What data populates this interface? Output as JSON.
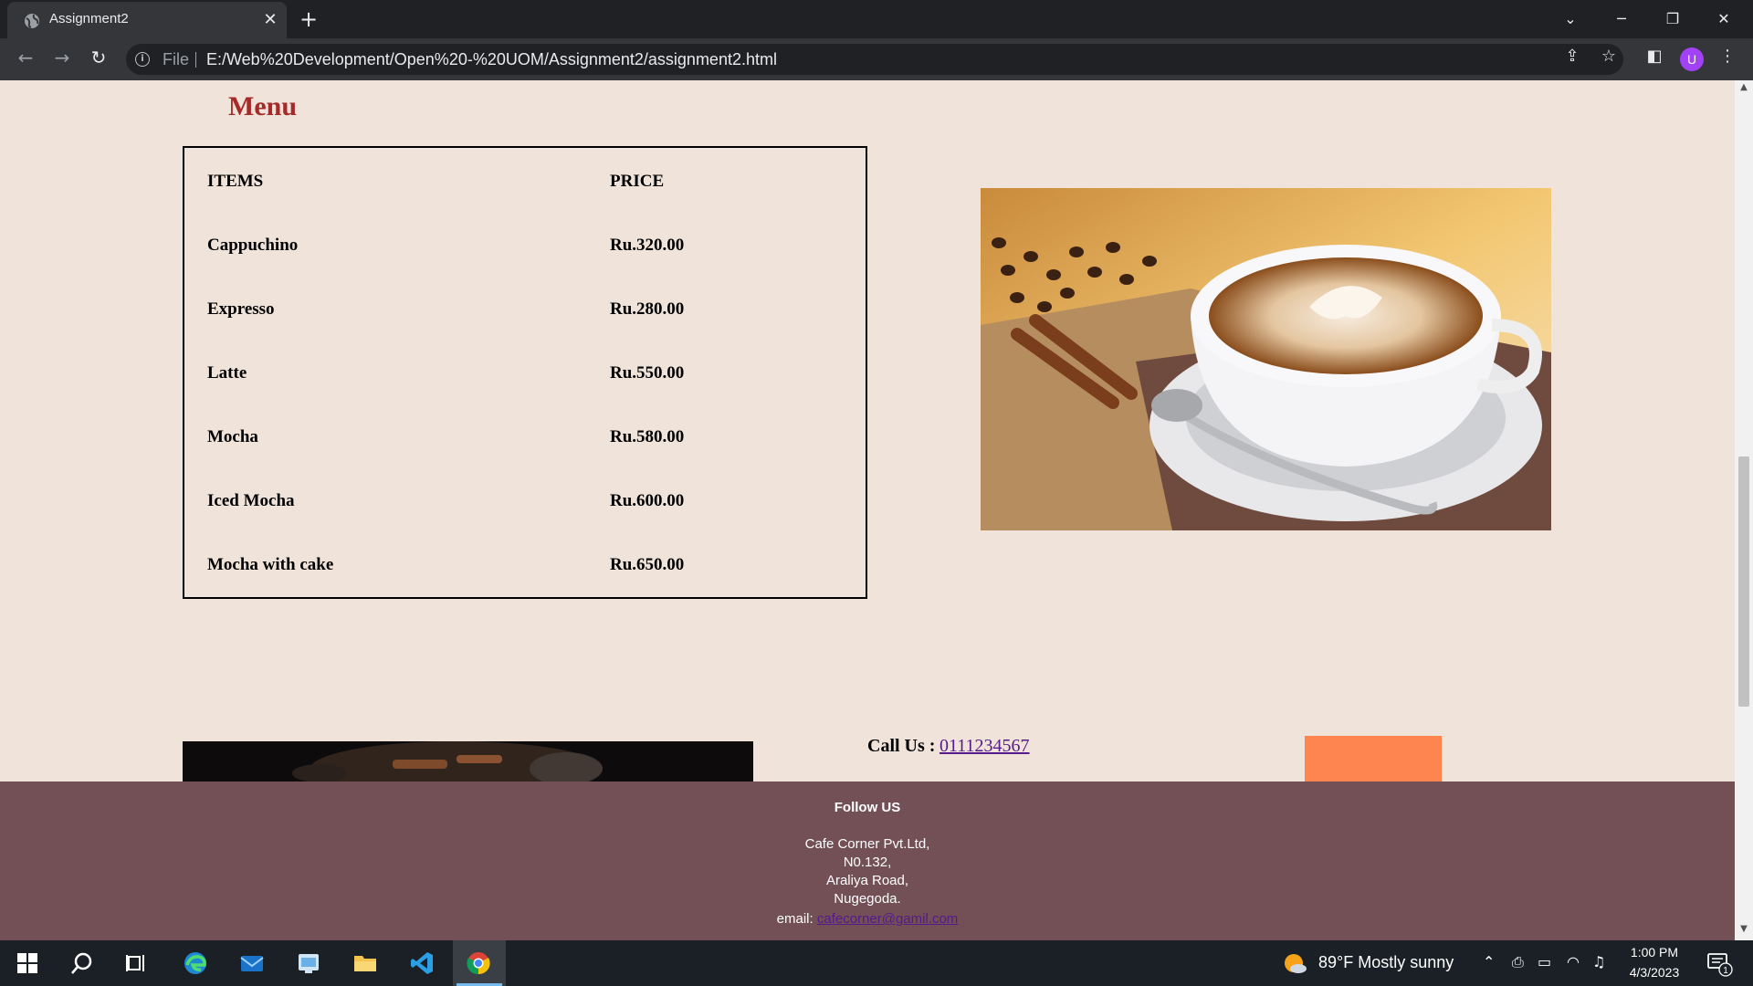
{
  "browser": {
    "tab_title": "Assignment2",
    "tab_close": "✕",
    "new_tab": "+",
    "scheme_label": "File",
    "url": "E:/Web%20Development/Open%20-%20UOM/Assignment2/assignment2.html",
    "profile_initial": "U"
  },
  "page": {
    "menu_heading": "Menu",
    "table": {
      "headers": [
        "ITEMS",
        "PRICE"
      ],
      "rows": [
        {
          "item": "Cappuchino",
          "price": "Ru.320.00"
        },
        {
          "item": "Expresso",
          "price": "Ru.280.00"
        },
        {
          "item": "Latte",
          "price": "Ru.550.00"
        },
        {
          "item": "Mocha",
          "price": "Ru.580.00"
        },
        {
          "item": "Iced Mocha",
          "price": "Ru.600.00"
        },
        {
          "item": "Mocha with cake",
          "price": "Ru.650.00"
        }
      ]
    },
    "call_label": "Call Us :",
    "call_number": "0111234567"
  },
  "footer": {
    "follow": "Follow US",
    "address": [
      "Cafe Corner Pvt.Ltd,",
      "N0.132,",
      "Araliya Road,",
      "Nugegoda."
    ],
    "email_label": "email:",
    "email": "cafecorner@gamil.com"
  },
  "taskbar": {
    "weather": "89°F  Mostly sunny",
    "time": "1:00 PM",
    "date": "4/3/2023",
    "notification_count": "1"
  },
  "colors": {
    "page_bg": "#f0e3da",
    "heading": "#a52a2a",
    "footer_bg": "#725056",
    "orange_box": "#ff8550",
    "link": "#551a8b"
  }
}
